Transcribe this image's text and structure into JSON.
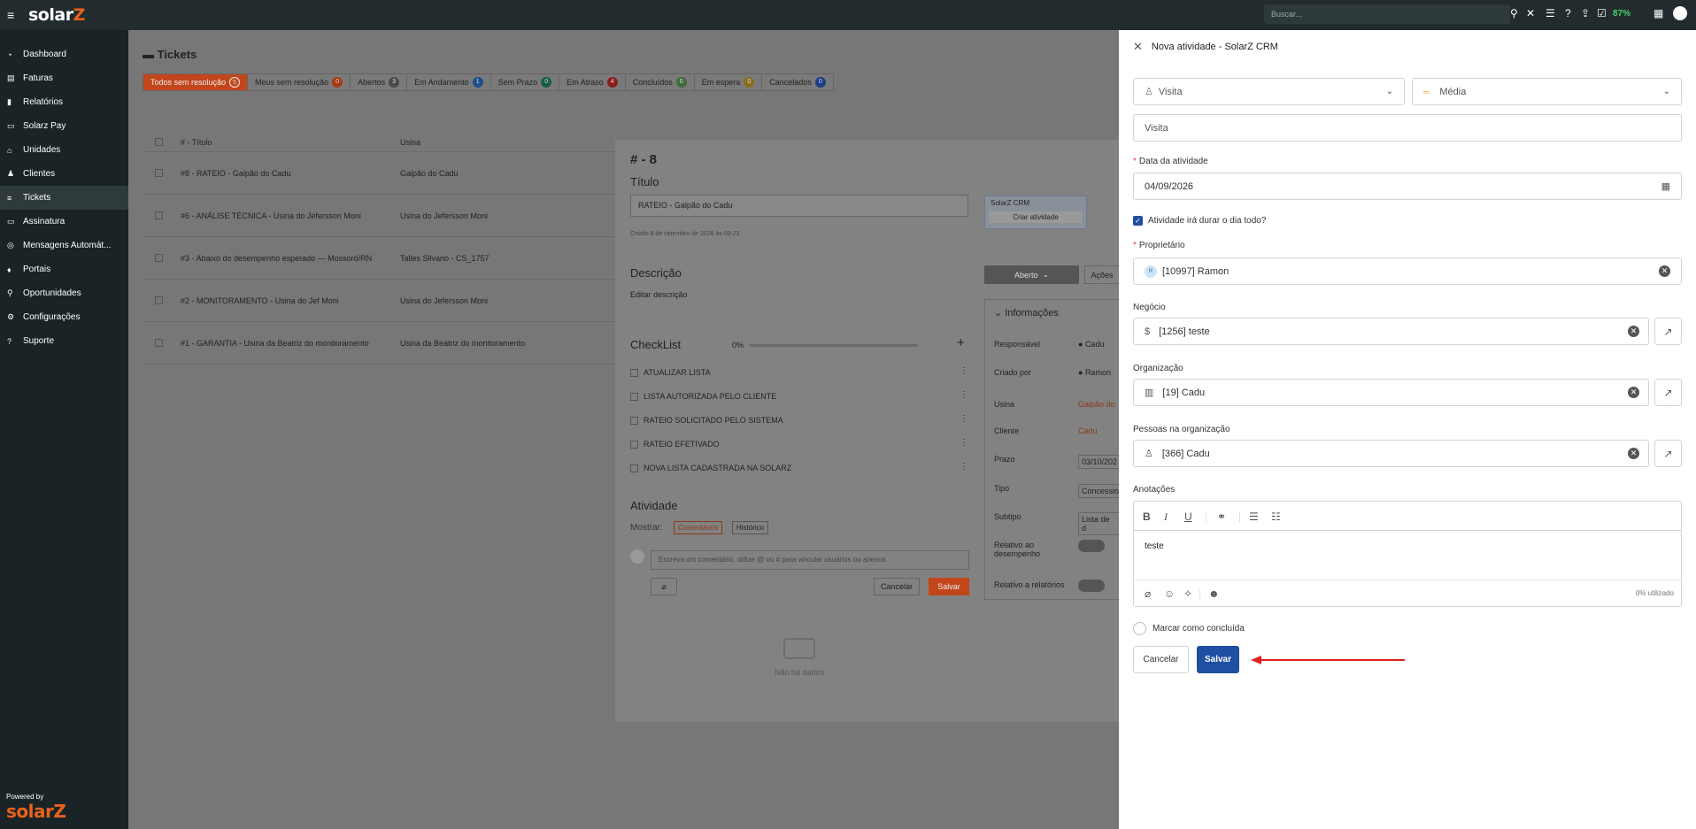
{
  "topbar": {
    "logo_text": "solar",
    "logo_z": "Z",
    "search_placeholder": "Buscar...",
    "battery": "87%"
  },
  "sidebar": {
    "items": [
      {
        "icon": "◔",
        "label": "Dashboard"
      },
      {
        "icon": "▤",
        "label": "Faturas"
      },
      {
        "icon": "▮",
        "label": "Relatórios"
      },
      {
        "icon": "▭",
        "label": "Solarz Pay"
      },
      {
        "icon": "⌂",
        "label": "Unidades"
      },
      {
        "icon": "♟",
        "label": "Clientes"
      },
      {
        "icon": "≡",
        "label": "Tickets"
      },
      {
        "icon": "▭",
        "label": "Assinatura"
      },
      {
        "icon": "◎",
        "label": "Mensagens Automát..."
      },
      {
        "icon": "♦",
        "label": "Portais"
      },
      {
        "icon": "⚲",
        "label": "Oportunidades"
      },
      {
        "icon": "⚙",
        "label": "Configurações"
      },
      {
        "icon": "?",
        "label": "Suporte"
      }
    ],
    "powered_by": "Powered by",
    "powered_logo": "solarZ"
  },
  "tickets": {
    "title": "Tickets",
    "tabs": [
      {
        "label": "Todos sem resolução",
        "count": "5",
        "color": "#c2461b"
      },
      {
        "label": "Meus sem resolução",
        "count": "0",
        "color": "#a33b17"
      },
      {
        "label": "Abertos",
        "count": "3",
        "color": "#4a4a4a"
      },
      {
        "label": "Em Andamento",
        "count": "1",
        "color": "#1e4f86"
      },
      {
        "label": "Sem Prazo",
        "count": "0",
        "color": "#1a5a4a"
      },
      {
        "label": "Em Atraso",
        "count": "4",
        "color": "#8a1f1f"
      },
      {
        "label": "Concluídos",
        "count": "0",
        "color": "#3f6a3a"
      },
      {
        "label": "Em espera",
        "count": "0",
        "color": "#8a6d1f"
      },
      {
        "label": "Cancelados",
        "count": "0",
        "color": "#1e3f86"
      }
    ],
    "columns": [
      "# - Título",
      "Usina"
    ],
    "rows": [
      {
        "title": "#8 - RATEIO - Galpão do Cadu",
        "usina": "Galpão do Cadu"
      },
      {
        "title": "#6 - ANÁLISE TÉCNICA - Usina do Jefersson Moni",
        "usina": "Usina do Jefersson Moni"
      },
      {
        "title": "#3 - Abaixo do desempenho esperado — Mossoró/RN",
        "usina": "Talles Silvano - CS_1757"
      },
      {
        "title": "#2 - MONITORAMENTO - Usina do Jef Moni",
        "usina": "Usina do Jefersson Moni"
      },
      {
        "title": "#1 - GARANTIA - Usina da Beatriz do monitoramento",
        "usina": "Usina da Beatriz do monitoramento"
      }
    ]
  },
  "ticket_modal": {
    "title": "# - 8",
    "titulo_label": "Título",
    "titulo_value": "RATEIO - Galpão do Cadu",
    "created_text": "Criado 8 de setembro de 2026 às 09:23",
    "crm_label": "SolarZ CRM",
    "criar_atividade": "Criar atividade",
    "descricao_label": "Descrição",
    "editar_descricao": "Editar descrição",
    "status_button": "Aberto",
    "acoes_button": "Ações",
    "checklist_label": "CheckList",
    "checklist_progress": "0%",
    "checklist_items": [
      "ATUALIZAR LISTA",
      "LISTA AUTORIZADA PELO CLIENTE",
      "RATEIO SOLICITADO PELO SISTEMA",
      "RATEIO EFETIVADO",
      "NOVA LISTA CADASTRADA NA SOLARZ"
    ],
    "info_label": "Informações",
    "info_rows": [
      {
        "label": "Responsável",
        "value": "Cadu"
      },
      {
        "label": "Criado por",
        "value": "Ramon"
      },
      {
        "label": "Usina",
        "value": "Galpão do"
      },
      {
        "label": "Cliente",
        "value": "Cadu"
      },
      {
        "label": "Prazo",
        "value": "03/10/202"
      },
      {
        "label": "Tipo",
        "value": "Concessio"
      },
      {
        "label": "Subtipo",
        "value": "Lista de d"
      }
    ],
    "relativo_desempenho": "Relativo ao desempenho",
    "relativo_relatorios": "Relativo a relatórios",
    "atividade_label": "Atividade",
    "mostrar_label": "Mostrar:",
    "comentarios_tab": "Comentários",
    "historico_tab": "Histórico",
    "comment_placeholder": "Escreva um comentário, utilize @ ou # para vincular usuários ou anexos",
    "cancelar": "Cancelar",
    "salvar": "Salvar",
    "empty_text": "Não há dados"
  },
  "drawer": {
    "title": "Nova atividade - SolarZ CRM",
    "type_value": "Visita",
    "priority_value": "Média",
    "subject_value": "Visita",
    "date_label": "Data da atividade",
    "date_value": "04/09/2026",
    "all_day_label": "Atividade irá durar o dia todo?",
    "owner_label": "Proprietário",
    "owner_initial": "R",
    "owner_value": "[10997] Ramon",
    "negocio_label": "Negócio",
    "negocio_value": "[1256] teste",
    "org_label": "Organização",
    "org_value": "[19] Cadu",
    "pessoas_label": "Pessoas na organização",
    "pessoas_value": "[366] Cadu",
    "anotacoes_label": "Anotações",
    "anotacoes_value": "teste",
    "usage_text": "0% utilizado",
    "concluida_label": "Marcar como concluída",
    "cancel_button": "Cancelar",
    "save_button": "Salvar",
    "accent_color": "#1f4fa0",
    "arrow_color": "#e02020"
  }
}
